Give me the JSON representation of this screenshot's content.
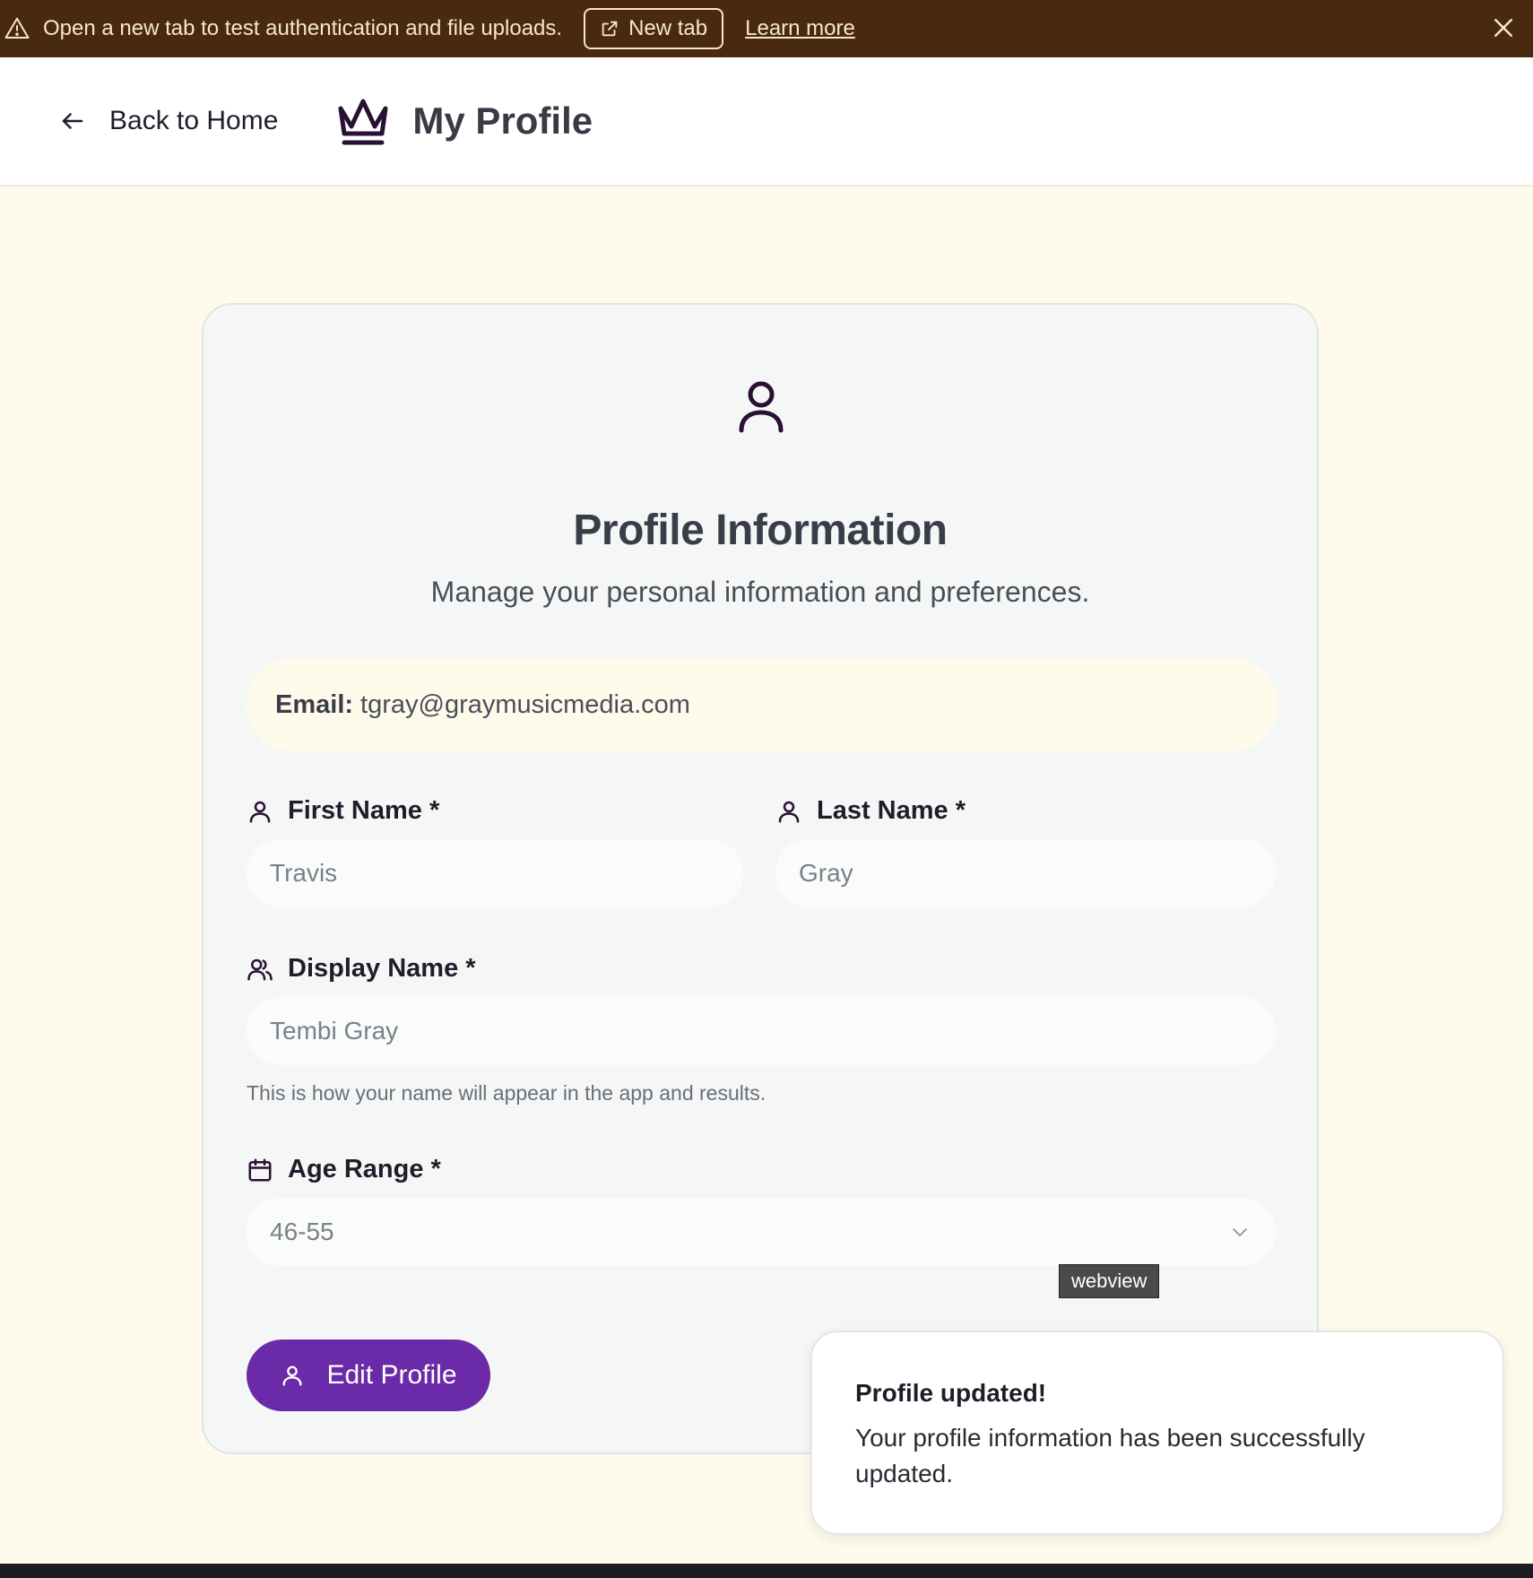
{
  "banner": {
    "message": "Open a new tab to test authentication and file uploads.",
    "new_tab_label": "New tab",
    "learn_more_label": "Learn more",
    "bg_color": "#4a2a0e"
  },
  "header": {
    "back_label": "Back to Home",
    "title": "My Profile"
  },
  "card": {
    "title": "Profile Information",
    "subtitle": "Manage your personal information and preferences.",
    "email_label": "Email:",
    "email_value": "tgray@graymusicmedia.com",
    "first_name_label": "First Name *",
    "first_name_value": "Travis",
    "last_name_label": "Last Name *",
    "last_name_value": "Gray",
    "display_name_label": "Display Name *",
    "display_name_value": "Tembi Gray",
    "display_name_help": "This is how your name will appear in the app and results.",
    "age_range_label": "Age Range *",
    "age_range_value": "46-55",
    "edit_button_label": "Edit Profile",
    "accent_color": "#6b2aa8"
  },
  "tooltip": {
    "text": "webview"
  },
  "toast": {
    "title": "Profile updated!",
    "body": "Your profile information has been successfully updated."
  }
}
